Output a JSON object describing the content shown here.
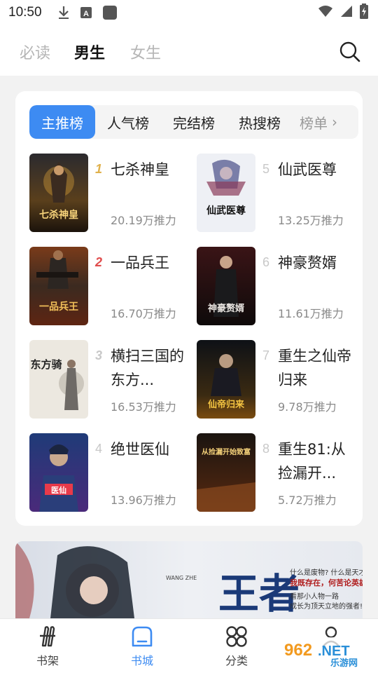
{
  "status_bar": {
    "time": "10:50",
    "icons": [
      "download-icon",
      "keyboard-a-icon",
      "app-square-icon",
      "wifi-icon",
      "signal-icon",
      "battery-charging-icon"
    ]
  },
  "top_tabs": [
    {
      "label": "必读",
      "active": false
    },
    {
      "label": "男生",
      "active": true
    },
    {
      "label": "女生",
      "active": false
    }
  ],
  "rank_tabs": [
    {
      "label": "主推榜",
      "active": true
    },
    {
      "label": "人气榜",
      "active": false
    },
    {
      "label": "完结榜",
      "active": false
    },
    {
      "label": "热搜榜",
      "active": false
    }
  ],
  "rank_tab_more": "榜单",
  "books": [
    {
      "rank": "1",
      "title": "七杀神皇",
      "score": "20.19万推力"
    },
    {
      "rank": "2",
      "title": "一品兵王",
      "score": "16.70万推力"
    },
    {
      "rank": "3",
      "title": "横扫三国的东方...",
      "score": "16.53万推力"
    },
    {
      "rank": "4",
      "title": "绝世医仙",
      "score": "13.96万推力"
    },
    {
      "rank": "5",
      "title": "仙武医尊",
      "score": "13.25万推力"
    },
    {
      "rank": "6",
      "title": "神豪赘婿",
      "score": "11.61万推力"
    },
    {
      "rank": "7",
      "title": "重生之仙帝归来",
      "score": "9.78万推力"
    },
    {
      "rank": "8",
      "title": "重生81:从捡漏开...",
      "score": "5.72万推力"
    }
  ],
  "covers": {
    "c1": "七杀神皇",
    "c2": "一品兵王",
    "c3": "东方骑",
    "c4": "医仙",
    "c5": "仙武医尊",
    "c6": "神豪赘婿",
    "c7": "仙帝归来",
    "c8": "从捡漏开始致富"
  },
  "banner": {
    "title": "王者",
    "line1": "什么是废物? 什么是天才?",
    "line2": "我既存在，何苦论英雄!",
    "line3": "看那小人物一路",
    "line4": "成长为顶天立地的强者!",
    "tag": "WANG ZHE"
  },
  "bottom_nav": [
    {
      "label": "书架",
      "icon": "bookshelf-icon",
      "active": false
    },
    {
      "label": "书城",
      "icon": "bookstore-icon",
      "active": true
    },
    {
      "label": "分类",
      "icon": "category-icon",
      "active": false
    }
  ],
  "watermark": {
    "text1": "962",
    "text2": ".NET",
    "text3": "乐游网"
  },
  "colors": {
    "accent": "#3d8bf2",
    "rank1": "#e0b14c",
    "rank2": "#e04d4d"
  }
}
